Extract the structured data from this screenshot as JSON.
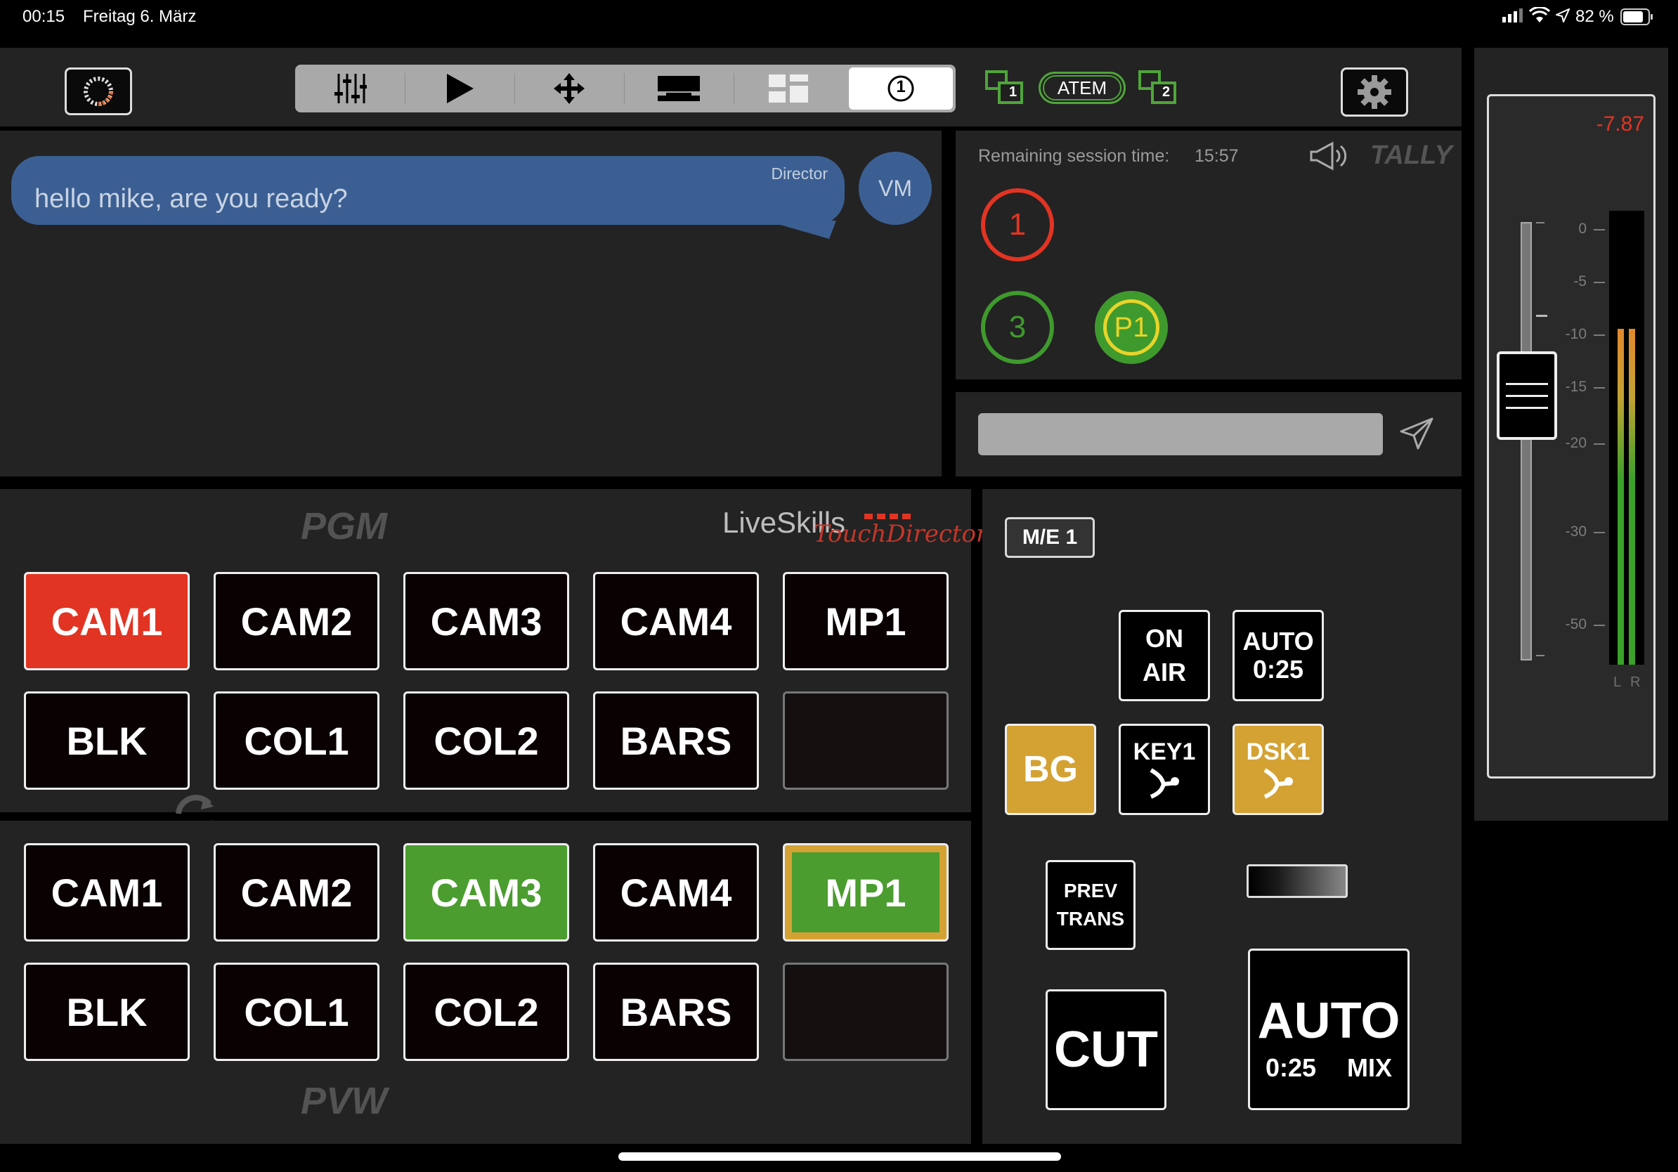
{
  "status_bar": {
    "time": "00:15",
    "date": "Freitag 6. März",
    "battery": "82 %"
  },
  "toolbar": {
    "buttons": [
      "mixer-sliders-icon",
      "play-icon",
      "move-arrows-icon",
      "lower-third-icon",
      "multiview-icon"
    ],
    "active_me_label": "1",
    "device_label": "ATEM",
    "me1_label": "1",
    "me2_label": "2"
  },
  "chat": {
    "message": "hello mike, are you ready?",
    "sender": "Director",
    "avatar": "VM",
    "input_placeholder": ""
  },
  "tally": {
    "session_label": "Remaining session time:",
    "session_time": "15:57",
    "title": "TALLY",
    "program_indicator": "1",
    "preview_indicators": [
      "3",
      "P1"
    ]
  },
  "program_bus": {
    "title": "PGM",
    "brand_main": "LiveSkills",
    "brand_sub": "TouchDirector",
    "row1": [
      "CAM1",
      "CAM2",
      "CAM3",
      "CAM4",
      "MP1"
    ],
    "row2": [
      "BLK",
      "COL1",
      "COL2",
      "BARS",
      ""
    ]
  },
  "preview_bus": {
    "title": "PVW",
    "row1": [
      "CAM1",
      "CAM2",
      "CAM3",
      "CAM4",
      "MP1"
    ],
    "row2": [
      "BLK",
      "COL1",
      "COL2",
      "BARS",
      ""
    ]
  },
  "transition": {
    "me_label": "M/E 1",
    "on_air_line1": "ON",
    "on_air_line2": "AIR",
    "auto_small_line1": "AUTO",
    "auto_small_line2": "0:25",
    "bg_label": "BG",
    "key1_label": "KEY1",
    "dsk1_label": "DSK1",
    "prev_trans_line1": "PREV",
    "prev_trans_line2": "TRANS",
    "cut_label": "CUT",
    "auto_label": "AUTO",
    "auto_rate": "0:25",
    "auto_type": "MIX"
  },
  "audio": {
    "level_readout": "-7.87",
    "scale": [
      "0",
      "-5",
      "-10",
      "-15",
      "-20",
      "-30",
      "-50"
    ],
    "channels": "L R",
    "meter_level_fraction": 0.74
  },
  "colors": {
    "program_red": "#e23423",
    "preview_green": "#4a9d2e",
    "active_gold": "#d4a233",
    "chat_blue": "#3b5f93",
    "panel_bg": "#232323"
  }
}
